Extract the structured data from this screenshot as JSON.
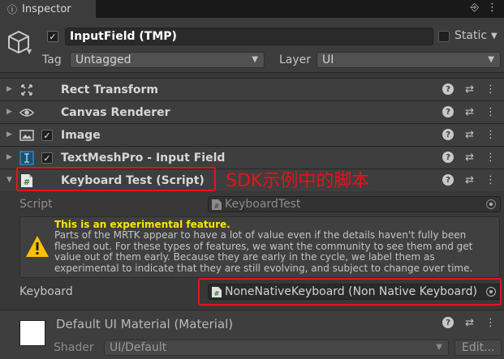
{
  "tab": {
    "title": "Inspector",
    "icon": "info-icon"
  },
  "gameobject": {
    "name": "InputField (TMP)",
    "active": true,
    "static_label": "Static",
    "static": false,
    "tag_label": "Tag",
    "tag_value": "Untagged",
    "layer_label": "Layer",
    "layer_value": "UI"
  },
  "components": [
    {
      "name": "Rect Transform",
      "icon": "rect-transform-icon",
      "has_checkbox": false
    },
    {
      "name": "Canvas Renderer",
      "icon": "eye-icon",
      "has_checkbox": false
    },
    {
      "name": "Image",
      "icon": "image-icon",
      "has_checkbox": true,
      "enabled": true
    },
    {
      "name": "TextMeshPro - Input Field",
      "icon": "textmeshpro-icon",
      "has_checkbox": true,
      "enabled": true
    },
    {
      "name": "Keyboard Test (Script)",
      "icon": "script-icon",
      "has_checkbox": false
    }
  ],
  "keyboard_test": {
    "script_label": "Script",
    "script_value": "KeyboardTest",
    "warning_title": "This is an experimental feature.",
    "warning_text": "Parts of the MRTK appear to have a lot of value even if the details haven't fully been fleshed out. For these types of features, we want the community to see them and get value out of them early. Because they are early in the cycle, we label them as experimental to indicate that they are still evolving, and subject to change over time.",
    "keyboard_label": "Keyboard",
    "keyboard_value": "NoneNativeKeyboard (Non Native Keyboard)"
  },
  "material": {
    "name": "Default UI Material (Material)",
    "shader_label": "Shader",
    "shader_value": "UI/Default",
    "edit_label": "Edit..."
  },
  "annotation": {
    "text": "SDK示例中的脚本",
    "color": "#e8121a"
  },
  "colors": {
    "warning": "#ffe600",
    "panel": "#383838",
    "header": "#3e3e3e"
  }
}
